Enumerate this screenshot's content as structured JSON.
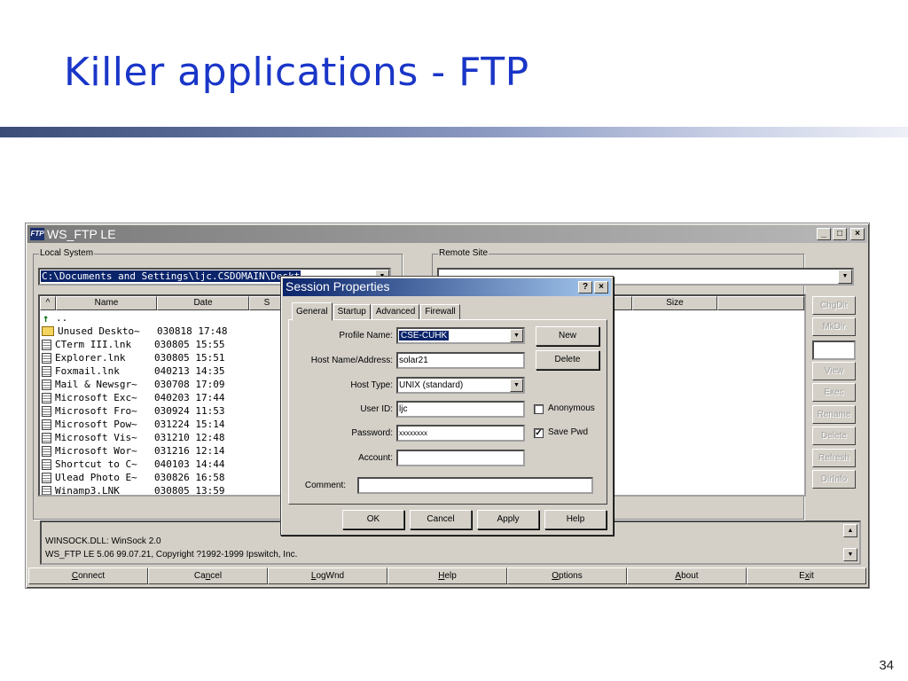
{
  "slide": {
    "title": "Killer applications - FTP",
    "number": "34"
  },
  "window": {
    "title": "WS_FTP LE",
    "icon": "ftp-app-icon",
    "controls": {
      "minimize": "_",
      "maximize": "□",
      "close": "×"
    },
    "local": {
      "group_label": "Local System",
      "path": "C:\\Documents and Settings\\ljc.CSDOMAIN\\Deskt",
      "columns": [
        "^",
        "Name",
        "Date",
        "S"
      ],
      "files": [
        {
          "icon": "up-folder-icon",
          "name": "..",
          "date": ""
        },
        {
          "icon": "folder-icon",
          "name": "Unused Deskto~",
          "date": "030818 17:48"
        },
        {
          "icon": "file-icon",
          "name": "CTerm III.lnk",
          "date": "030805 15:55"
        },
        {
          "icon": "file-icon",
          "name": "Explorer.lnk",
          "date": "030805 15:51"
        },
        {
          "icon": "file-icon",
          "name": "Foxmail.lnk",
          "date": "040213 14:35"
        },
        {
          "icon": "file-icon",
          "name": "Mail & Newsgr~",
          "date": "030708 17:09"
        },
        {
          "icon": "file-icon",
          "name": "Microsoft Exc~",
          "date": "040203 17:44"
        },
        {
          "icon": "file-icon",
          "name": "Microsoft Fro~",
          "date": "030924 11:53"
        },
        {
          "icon": "file-icon",
          "name": "Microsoft Pow~",
          "date": "031224 15:14"
        },
        {
          "icon": "file-icon",
          "name": "Microsoft Vis~",
          "date": "031210 12:48"
        },
        {
          "icon": "file-icon",
          "name": "Microsoft Wor~",
          "date": "031216 12:14"
        },
        {
          "icon": "file-icon",
          "name": "Shortcut to C~",
          "date": "040103 14:44"
        },
        {
          "icon": "file-icon",
          "name": "Ulead Photo E~",
          "date": "030826 16:58"
        },
        {
          "icon": "file-icon",
          "name": "Winamp3.LNK",
          "date": "030805 13:59"
        }
      ]
    },
    "remote": {
      "group_label": "Remote Site",
      "path": "",
      "columns": [
        "Size"
      ]
    },
    "side_buttons": [
      "ChgDir",
      "MkDir",
      "View",
      "Exec",
      "Rename",
      "Delete",
      "Refresh",
      "DirInfo"
    ],
    "log": [
      "WINSOCK.DLL: WinSock 2.0",
      "WS_FTP LE 5.06 99.07.21, Copyright ?1992-1999 Ipswitch, Inc."
    ],
    "bottom_buttons": [
      {
        "label": "Connect",
        "key": "C"
      },
      {
        "label": "Cancel",
        "key": "n"
      },
      {
        "label": "LogWnd",
        "key": "L"
      },
      {
        "label": "Help",
        "key": "H"
      },
      {
        "label": "Options",
        "key": "O"
      },
      {
        "label": "About",
        "key": "A"
      },
      {
        "label": "Exit",
        "key": "x"
      }
    ]
  },
  "dialog": {
    "title": "Session Properties",
    "controls": {
      "help": "?",
      "close": "×"
    },
    "tabs": [
      "General",
      "Startup",
      "Advanced",
      "Firewall"
    ],
    "active_tab": "General",
    "fields": {
      "profile_name": {
        "label": "Profile Name:",
        "value": "CSE-CUHK"
      },
      "host_name": {
        "label": "Host Name/Address:",
        "value": "solar21"
      },
      "host_type": {
        "label": "Host Type:",
        "value": "UNIX (standard)"
      },
      "user_id": {
        "label": "User ID:",
        "value": "ljc"
      },
      "password": {
        "label": "Password:",
        "value": "xxxxxxxx"
      },
      "account": {
        "label": "Account:",
        "value": ""
      },
      "comment": {
        "label": "Comment:",
        "value": ""
      }
    },
    "buttons": {
      "new": "New",
      "delete": "Delete"
    },
    "checkboxes": {
      "anonymous": {
        "label": "Anonymous",
        "checked": false
      },
      "save_pwd": {
        "label": "Save Pwd",
        "checked": true,
        "mark": "✓"
      }
    },
    "footer_buttons": {
      "ok": "OK",
      "cancel": "Cancel",
      "apply": "Apply",
      "help": "Help"
    }
  }
}
